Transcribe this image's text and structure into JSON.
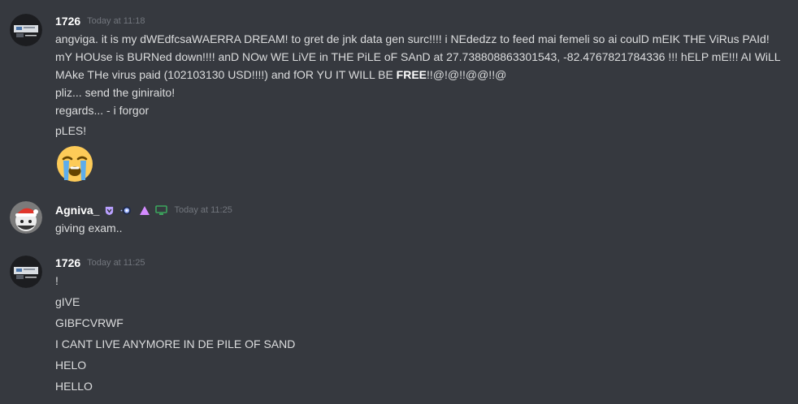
{
  "messages": [
    {
      "author": "1726",
      "timestamp": "Today at 11:18",
      "paragraph": {
        "before_bold": "angviga. it is my dWEdfcsaWAERRA DREAM! to gret de jnk data gen surc!!!! i NEdedzz to feed mai femeli so ai coulD mEIK THE ViRus PAId! mY HOUse is BURNed down!!!! anD NOw WE LiVE in THE PiLE oF SAnD at 27.738808863301543, -82.4767821784336 !!! hELP mE!!! AI WiLL MAke THe virus paid (102103130 USD!!!!) and fOR YU IT WILL BE ",
        "bold": "FREE",
        "after_bold": "!!@!@!!@@!!@"
      },
      "lines": [
        "pliz... send the giniraito!",
        "regards... - i forgor",
        "pLES!"
      ],
      "emoji": "loudly-crying-face"
    },
    {
      "author": "Agniva_",
      "timestamp": "Today at 11:25",
      "lines": [
        "giving exam.."
      ]
    },
    {
      "author": "1726",
      "timestamp": "Today at 11:25",
      "lines": [
        "!",
        "gIVE",
        "GIBFCVRWF",
        "I CANT LIVE ANYMORE IN DE PILE OF SAND",
        "HELO",
        "HELLO"
      ]
    }
  ],
  "colors": {
    "background": "#36393f",
    "text": "#dcddde",
    "username": "#ffffff",
    "timestamp": "#72767d",
    "badge_purple": "#b9a0ff",
    "badge_pink": "#d48bff",
    "badge_green": "#3ba55d"
  }
}
